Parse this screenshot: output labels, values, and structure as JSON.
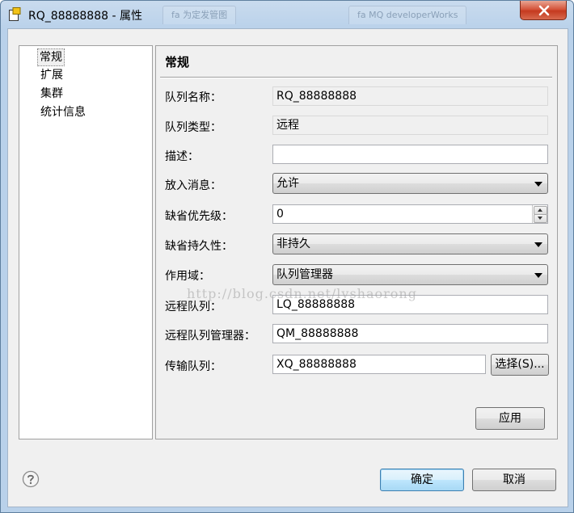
{
  "window": {
    "title": "RQ_88888888 - 属性",
    "background_tabs": [
      "fa 为定发管图",
      "fa MQ developerWorks"
    ]
  },
  "nav": {
    "items": [
      {
        "label": "常规",
        "selected": true
      },
      {
        "label": "扩展",
        "selected": false
      },
      {
        "label": "集群",
        "selected": false
      },
      {
        "label": "统计信息",
        "selected": false
      }
    ]
  },
  "content": {
    "section_title": "常规",
    "fields": {
      "queue_name": {
        "label": "队列名称：",
        "value": "RQ_88888888"
      },
      "queue_type": {
        "label": "队列类型：",
        "value": "远程"
      },
      "description": {
        "label": "描述：",
        "value": ""
      },
      "put_messages": {
        "label": "放入消息：",
        "value": "允许"
      },
      "default_priority": {
        "label": "缺省优先级：",
        "value": "0"
      },
      "default_persistence": {
        "label": "缺省持久性：",
        "value": "非持久"
      },
      "scope": {
        "label": "作用域：",
        "value": "队列管理器"
      },
      "remote_queue": {
        "label": "远程队列：",
        "value": "LQ_88888888"
      },
      "remote_qmgr": {
        "label": "远程队列管理器：",
        "value": "QM_88888888"
      },
      "xmit_queue": {
        "label": "传输队列：",
        "value": "XQ_88888888"
      }
    },
    "select_button": "选择(S)...",
    "apply_button": "应用"
  },
  "footer": {
    "ok_button": "确定",
    "cancel_button": "取消"
  },
  "watermark": "http://blog.csdn.net/lvshaorong",
  "colors": {
    "titlebar": "#b9d1ea",
    "close_button": "#c43a1f",
    "dialog_bg": "#f0f0f0",
    "default_button_border": "#3c7fb1"
  }
}
